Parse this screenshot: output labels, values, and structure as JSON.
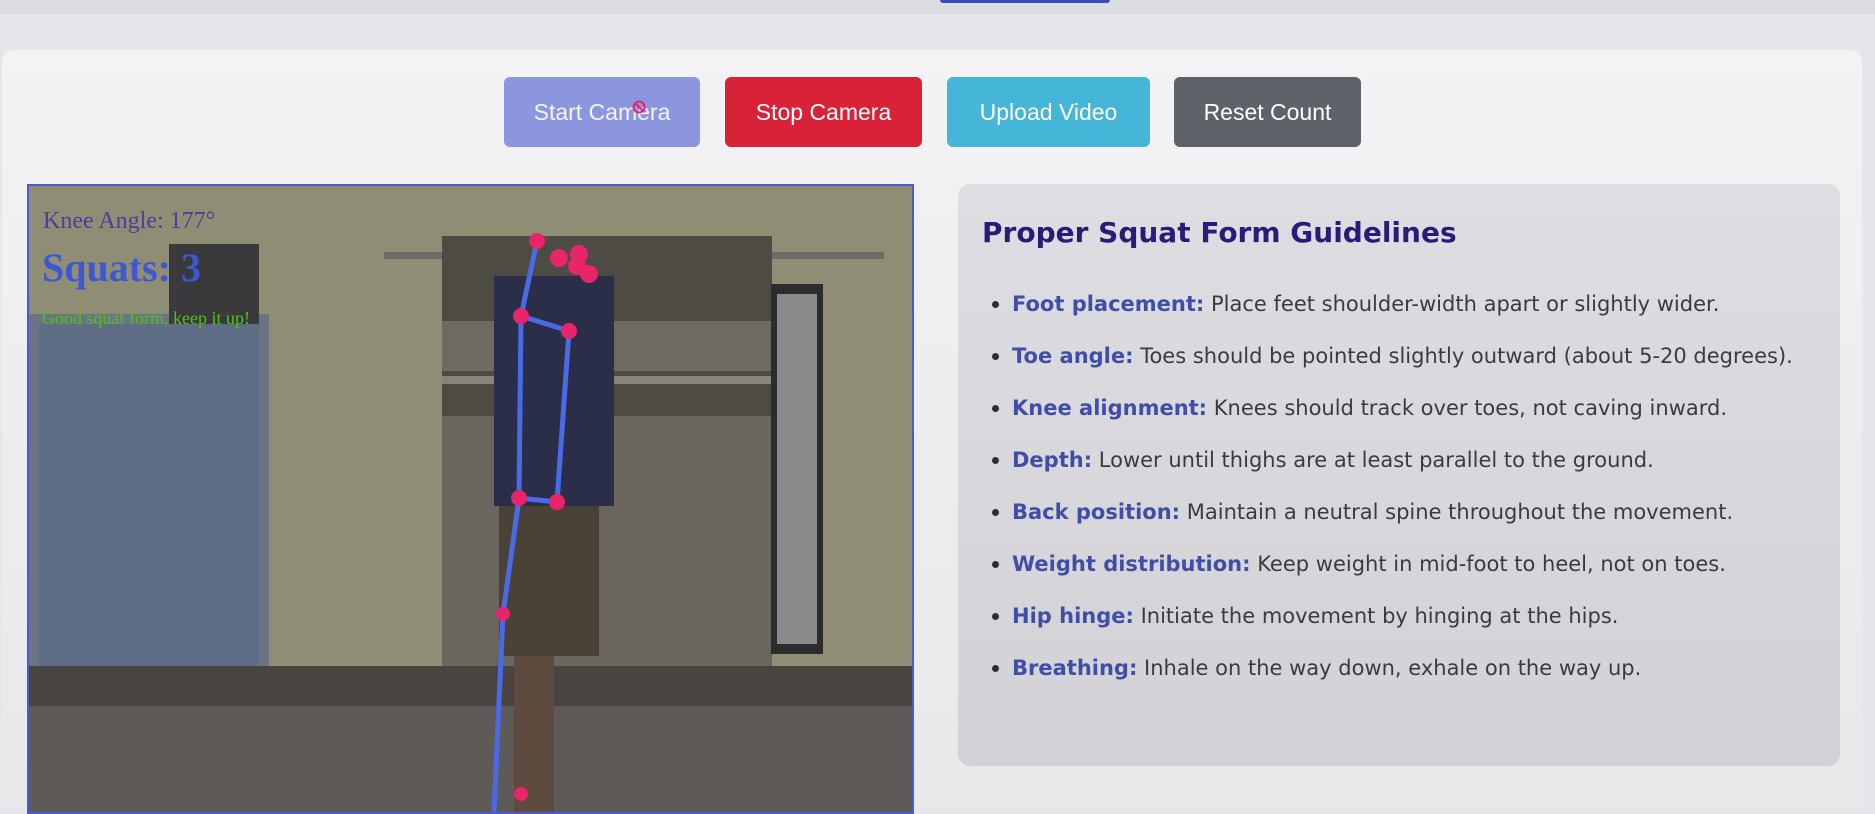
{
  "controls": {
    "start_camera": "Start Camera",
    "stop_camera": "Stop Camera",
    "upload_video": "Upload Video",
    "reset_count": "Reset Count"
  },
  "video_overlay": {
    "knee_angle": "Knee Angle: 177°",
    "squats": "Squats: 3",
    "feedback": "Good squat form, keep it up!"
  },
  "guidelines": {
    "title": "Proper Squat Form Guidelines",
    "items": [
      {
        "term": "Foot placement:",
        "text": "Place feet shoulder-width apart or slightly wider."
      },
      {
        "term": "Toe angle:",
        "text": "Toes should be pointed slightly outward (about 5-20 degrees)."
      },
      {
        "term": "Knee alignment:",
        "text": "Knees should track over toes, not caving inward."
      },
      {
        "term": "Depth:",
        "text": "Lower until thighs are at least parallel to the ground."
      },
      {
        "term": "Back position:",
        "text": "Maintain a neutral spine throughout the movement."
      },
      {
        "term": "Weight distribution:",
        "text": "Keep weight in mid-foot to heel, not on toes."
      },
      {
        "term": "Hip hinge:",
        "text": "Initiate the movement by hinging at the hips."
      },
      {
        "term": "Breathing:",
        "text": "Inhale on the way down, exhale on the way up."
      }
    ]
  },
  "colors": {
    "start": "#8b96de",
    "stop": "#d92238",
    "upload": "#45b6d8",
    "reset": "#5d6369",
    "skeleton_line": "#4a6ae6",
    "skeleton_joint": "#e8246a"
  }
}
